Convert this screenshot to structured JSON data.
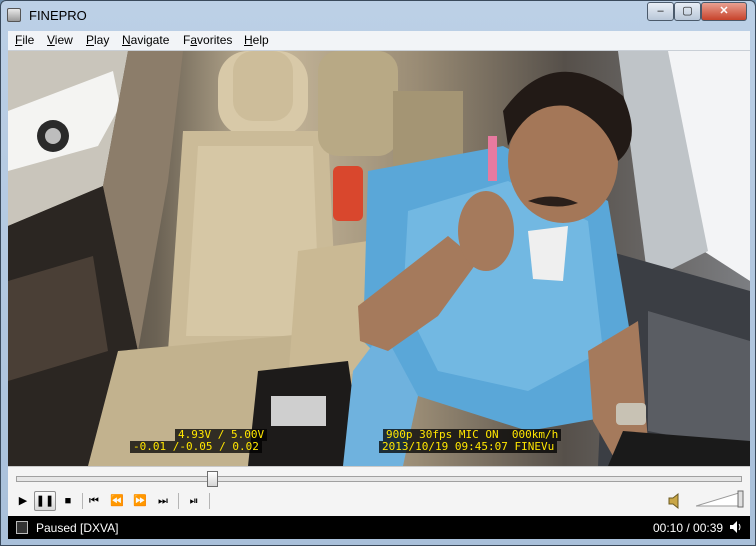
{
  "window": {
    "title": "FINEPRO",
    "controls": {
      "minimize": "‒",
      "maximize": "▢",
      "close": "✕"
    }
  },
  "menu": [
    {
      "label": "File",
      "accel": "F",
      "rest": "ile"
    },
    {
      "label": "View",
      "accel": "V",
      "rest": "iew"
    },
    {
      "label": "Play",
      "accel": "P",
      "rest": "lay"
    },
    {
      "label": "Navigate",
      "accel": "N",
      "rest": "avigate"
    },
    {
      "label": "Favorites",
      "accel": "a",
      "pre": "F",
      "rest": "vorites"
    },
    {
      "label": "Help",
      "accel": "H",
      "rest": "elp"
    }
  ],
  "video": {
    "osd_left_line1": "4.93V / 5.00V",
    "osd_left_line2": "-0.01 /-0.05 / 0.02",
    "osd_right_line1": "900p 30fps MIC ON  000km/h",
    "osd_right_line2": "2013/10/19 09:45:07 FINEVu"
  },
  "seek": {
    "position_fraction": 0.27
  },
  "controls": {
    "play": "▶",
    "pause": "❚❚",
    "stop": "■",
    "prev": "⏮",
    "rewind": "⏪",
    "forward": "⏩",
    "next": "⏭",
    "frame_step": "⏯"
  },
  "volume": {
    "level_fraction": 1.0
  },
  "status": {
    "text": "Paused [DXVA]",
    "time": "00:10 / 00:39"
  }
}
